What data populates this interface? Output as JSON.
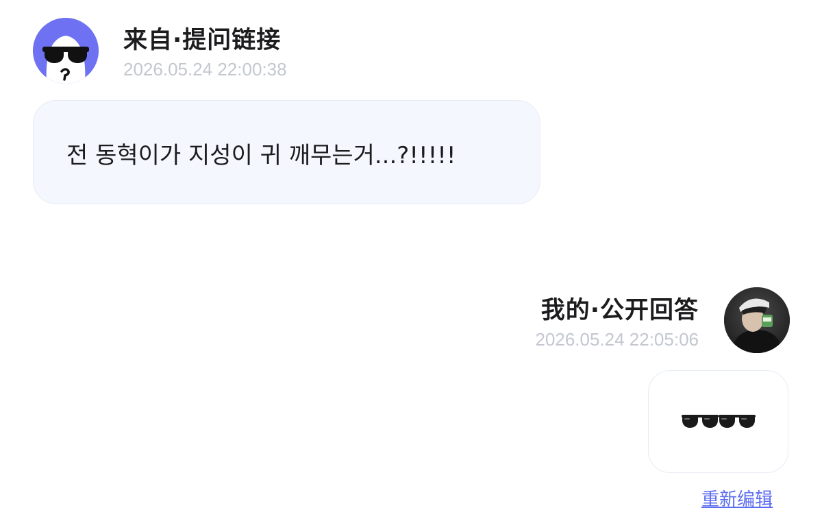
{
  "question": {
    "source_label": "来自·提问链接",
    "timestamp": "2026.05.24 22:00:38",
    "text": "전 동혁이가 지성이 귀 깨무는거...?!!!!!",
    "avatar_icon": "sunglasses-ghost-icon",
    "avatar_bg_color": "#6e72f2",
    "bubble_bg_color": "#f4f8fe"
  },
  "answer": {
    "label": "我的·公开回答",
    "timestamp": "2026.05.24 22:05:06",
    "content_icons": [
      "sunglasses-icon",
      "sunglasses-icon"
    ],
    "avatar_icon": "user-photo-avatar"
  },
  "actions": {
    "reedit_label": "重新编辑",
    "link_color": "#5b6cf0"
  }
}
